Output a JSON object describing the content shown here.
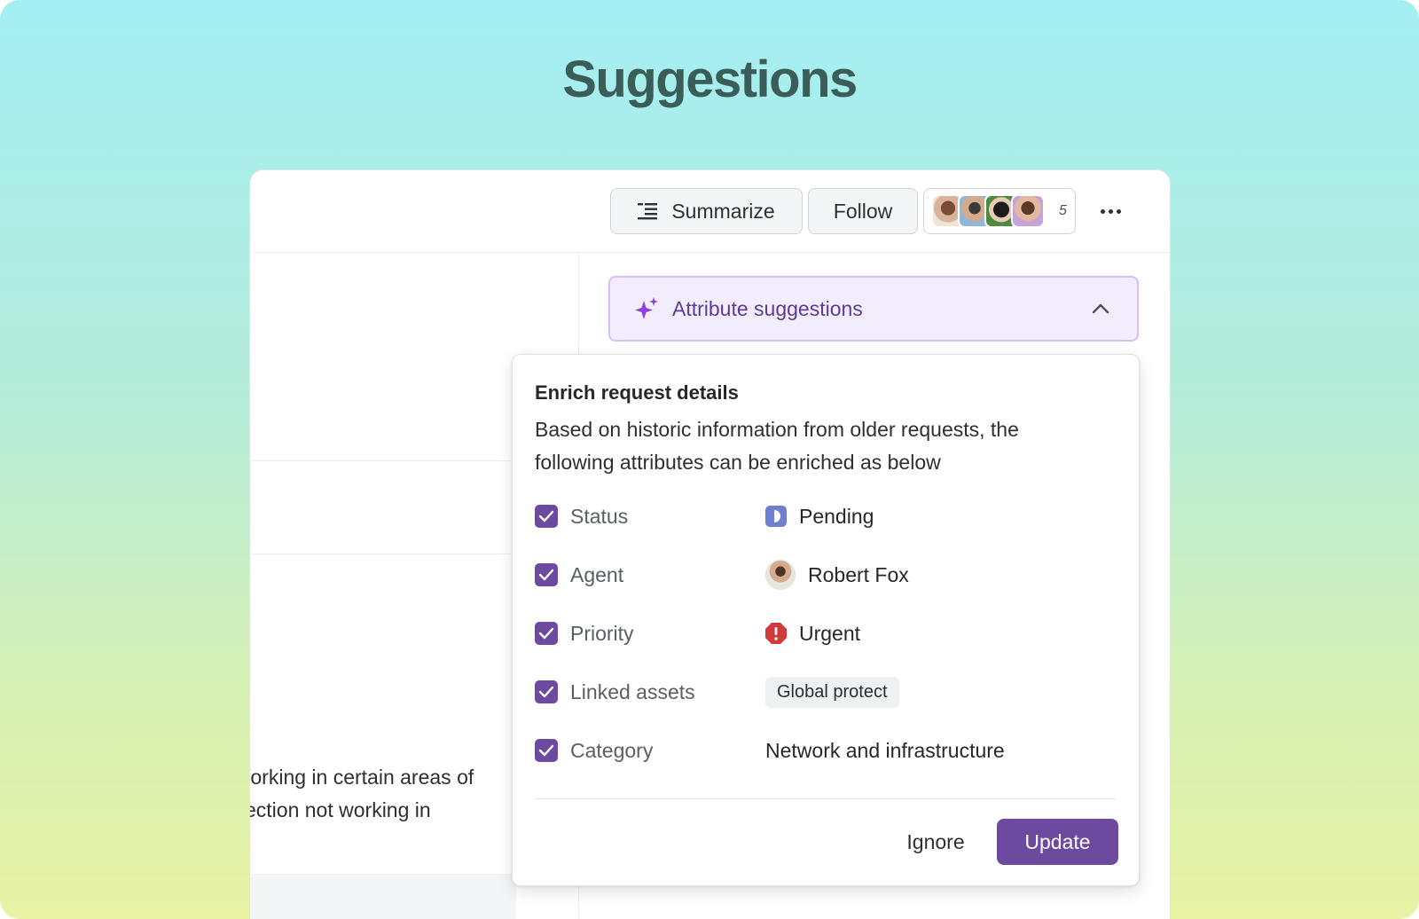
{
  "hero": {
    "title": "Suggestions"
  },
  "toolbar": {
    "summarize_label": "Summarize",
    "follow_label": "Follow",
    "participants_count": "5"
  },
  "attribute_bar": {
    "label": "Attribute suggestions"
  },
  "left_panel": {
    "text_lines": [
      "/orking in certain areas of",
      "ection not working in"
    ]
  },
  "popover": {
    "title": "Enrich request details",
    "description": "Based on historic information from older requests, the following attributes can be enriched as below",
    "rows": [
      {
        "name": "Status",
        "value": "Pending",
        "checked": true
      },
      {
        "name": "Agent",
        "value": "Robert Fox",
        "checked": true
      },
      {
        "name": "Priority",
        "value": "Urgent",
        "checked": true
      },
      {
        "name": "Linked assets",
        "value": "Global protect",
        "checked": true
      },
      {
        "name": "Category",
        "value": "Network and infrastructure",
        "checked": true
      }
    ],
    "ignore_label": "Ignore",
    "update_label": "Update"
  },
  "colors": {
    "accent": "#6b4aa0",
    "status_pending": "#6f7fcf",
    "priority_urgent": "#d13b3b",
    "title": "#3b5d58"
  },
  "icons": [
    "summarize-icon",
    "more-icon",
    "sparkle-icon",
    "chevron-up-icon",
    "check-icon",
    "pending-icon",
    "urgent-icon"
  ]
}
